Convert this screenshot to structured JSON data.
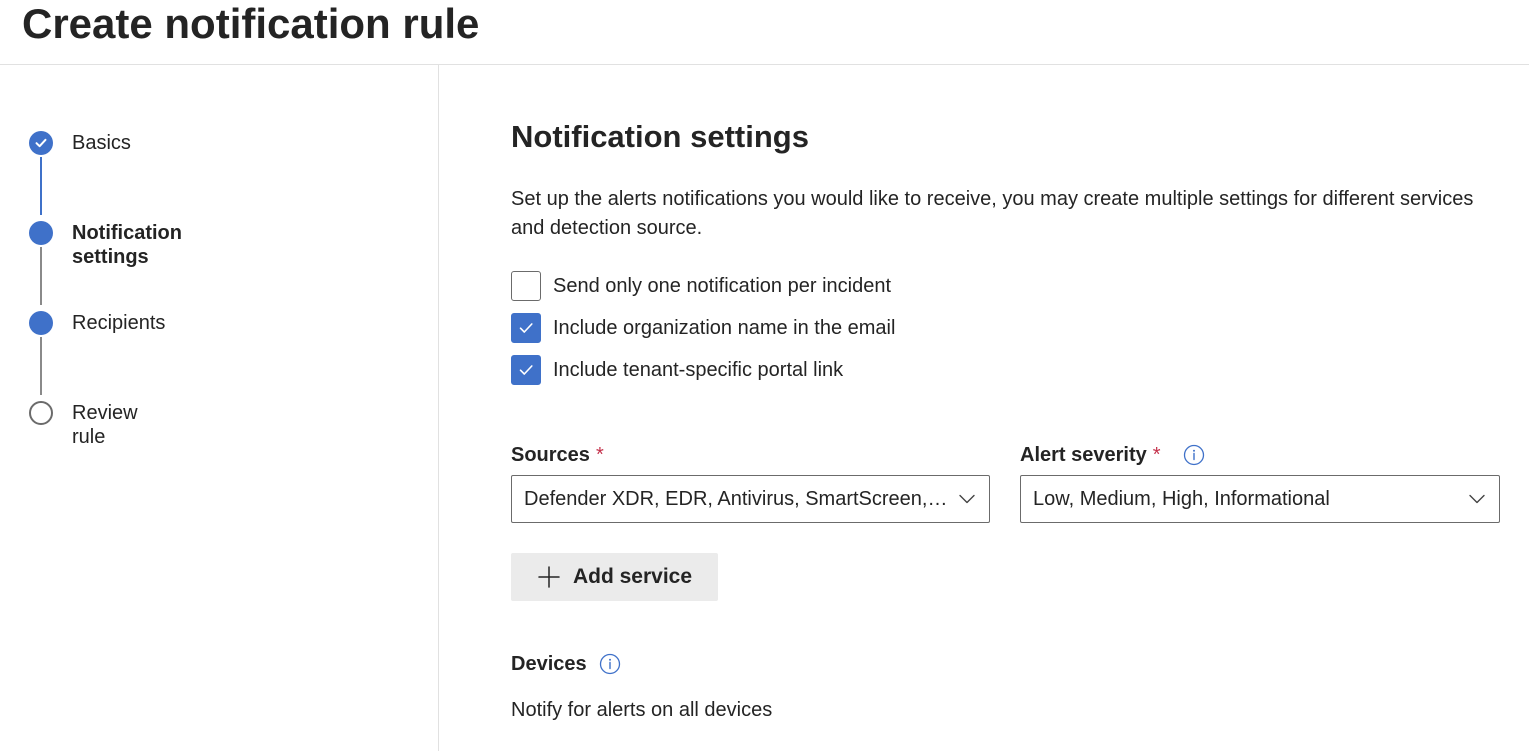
{
  "page": {
    "title": "Create notification rule"
  },
  "stepper": {
    "steps": [
      {
        "label": "Basics",
        "state": "completed"
      },
      {
        "label": "Notification settings",
        "state": "current"
      },
      {
        "label": "Recipients",
        "state": "upcoming-filled"
      },
      {
        "label": "Review rule",
        "state": "upcoming"
      }
    ]
  },
  "main": {
    "section_title": "Notification settings",
    "description": "Set up the alerts notifications you would like to receive, you may create multiple settings for different services and detection source.",
    "checkboxes": [
      {
        "label": "Send only one notification per incident",
        "checked": false
      },
      {
        "label": "Include organization name in the email",
        "checked": true
      },
      {
        "label": "Include tenant-specific portal link",
        "checked": true
      }
    ],
    "sources": {
      "label": "Sources",
      "required_marker": "*",
      "value": "Defender XDR, EDR, Antivirus, SmartScreen, Custom TI"
    },
    "alert_severity": {
      "label": "Alert severity",
      "required_marker": "*",
      "value": "Low, Medium, High, Informational"
    },
    "add_service_label": "Add service",
    "devices": {
      "label": "Devices",
      "text": "Notify for alerts on all devices"
    }
  },
  "colors": {
    "accent": "#3f71c9",
    "required": "#c4314b",
    "button_bg": "#ebebeb",
    "divider": "#e1e1e1"
  }
}
